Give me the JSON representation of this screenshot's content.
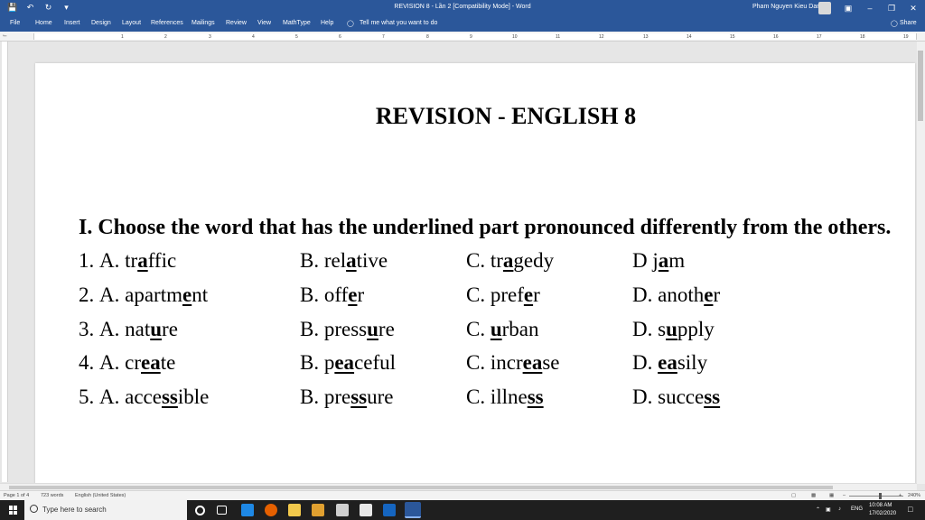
{
  "window": {
    "title": "REVISION 8 - Lần 2 [Compatibility Mode] - Word",
    "user": "Pham Nguyen Kieu Dan"
  },
  "menu": {
    "items": [
      "File",
      "Home",
      "Insert",
      "Design",
      "Layout",
      "References",
      "Mailings",
      "Review",
      "View",
      "MathType",
      "Help"
    ],
    "tell_me": "Tell me what you want to do",
    "share": "Share"
  },
  "ruler": {
    "numbers": [
      "1",
      "2",
      "3",
      "4",
      "5",
      "6",
      "7",
      "8",
      "9",
      "10",
      "11",
      "12",
      "13",
      "14",
      "15",
      "16",
      "17",
      "18",
      "19"
    ]
  },
  "document": {
    "title": "REVISION - ENGLISH 8",
    "heading": "I. Choose the word that has the underlined part pronounced differently from the others.",
    "questions": [
      {
        "number": "1.",
        "options": [
          {
            "label": "A.",
            "pre": "tr",
            "ul": "a",
            "post": "ffic"
          },
          {
            "label": "B.",
            "pre": "rel",
            "ul": "a",
            "post": "tive"
          },
          {
            "label": "C.",
            "pre": "tr",
            "ul": "a",
            "post": "gedy"
          },
          {
            "label": "D",
            "pre": "j",
            "ul": "a",
            "post": "m"
          }
        ]
      },
      {
        "number": "2.",
        "options": [
          {
            "label": "A.",
            "pre": "apartm",
            "ul": "e",
            "post": "nt"
          },
          {
            "label": "B.",
            "pre": "off",
            "ul": "e",
            "post": "r"
          },
          {
            "label": "C.",
            "pre": "pref",
            "ul": "e",
            "post": "r"
          },
          {
            "label": "D.",
            "pre": "anoth",
            "ul": "e",
            "post": "r"
          }
        ]
      },
      {
        "number": "3.",
        "options": [
          {
            "label": "A.",
            "pre": "nat",
            "ul": "u",
            "post": "re"
          },
          {
            "label": "B.",
            "pre": "press",
            "ul": "u",
            "post": "re"
          },
          {
            "label": "C.",
            "pre": "",
            "ul": "u",
            "post": "rban"
          },
          {
            "label": "D.",
            "pre": "s",
            "ul": "u",
            "post": "pply"
          }
        ]
      },
      {
        "number": "4.",
        "options": [
          {
            "label": "A.",
            "pre": "cr",
            "ul": "ea",
            "post": "te"
          },
          {
            "label": "B.",
            "pre": "p",
            "ul": "ea",
            "post": "ceful"
          },
          {
            "label": "C.",
            "pre": "incr",
            "ul": "ea",
            "post": "se"
          },
          {
            "label": "D.",
            "pre": "",
            "ul": "ea",
            "post": "sily"
          }
        ]
      },
      {
        "number": "5.",
        "options": [
          {
            "label": "A.",
            "pre": "acce",
            "ul": "ss",
            "post": "ible"
          },
          {
            "label": "B.",
            "pre": "pre",
            "ul": "ss",
            "post": "ure"
          },
          {
            "label": "C.",
            "pre": "illne",
            "ul": "ss",
            "post": ""
          },
          {
            "label": "D.",
            "pre": "succe",
            "ul": "ss",
            "post": ""
          }
        ]
      }
    ]
  },
  "status": {
    "page": "Page 1 of 4",
    "words": "723 words",
    "language": "English (United States)",
    "zoom": "240%"
  },
  "taskbar": {
    "search_placeholder": "Type here to search",
    "language": "ENG",
    "time": "10:08 AM",
    "date": "17/02/2020"
  }
}
